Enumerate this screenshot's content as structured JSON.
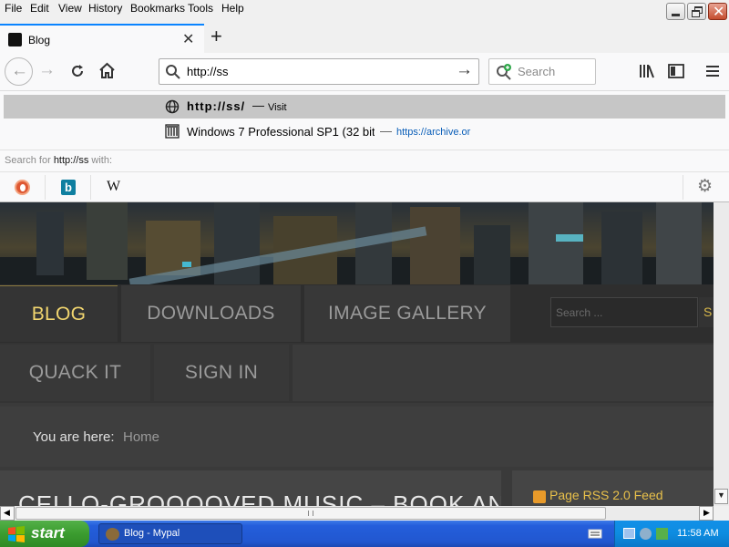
{
  "menu": {
    "file": "File",
    "edit": "Edit",
    "view": "View",
    "history": "History",
    "bookmarks": "Bookmarks",
    "tools": "Tools",
    "help": "Help"
  },
  "tab": {
    "title": "Blog"
  },
  "urlbar": {
    "value": "http://ss"
  },
  "searchbar": {
    "placeholder": "Search"
  },
  "suggestions": [
    {
      "url": "http://ss/",
      "separator": "—",
      "action": "Visit"
    },
    {
      "title": "Windows 7 Professional SP1 (32 bit",
      "separator": "—",
      "url": "https://archive.or"
    }
  ],
  "search_with": {
    "prefix": "Search for ",
    "query": "http://ss",
    "suffix": " with:"
  },
  "engines": [
    "duckduckgo-icon",
    "bing-icon",
    "wikipedia-icon"
  ],
  "site": {
    "nav": [
      "BLOG",
      "DOWNLOADS",
      "IMAGE GALLERY",
      "QUACK IT",
      "SIGN IN"
    ],
    "search_placeholder": "Search ...",
    "search_button": "S",
    "breadcrumb_label": "You are here:",
    "breadcrumb_home": "Home",
    "article_title": "CELLO-GROOOOVED MUSIC – BOOK AND",
    "rss": "Page RSS 2.0 Feed"
  },
  "taskbar": {
    "start": "start",
    "window": "Blog - Mypal",
    "clock": "11:58 AM"
  },
  "colors": {
    "accent_nav": "#f2d66f",
    "start_green": "#3b9c2f",
    "taskbar_blue": "#245edb"
  }
}
